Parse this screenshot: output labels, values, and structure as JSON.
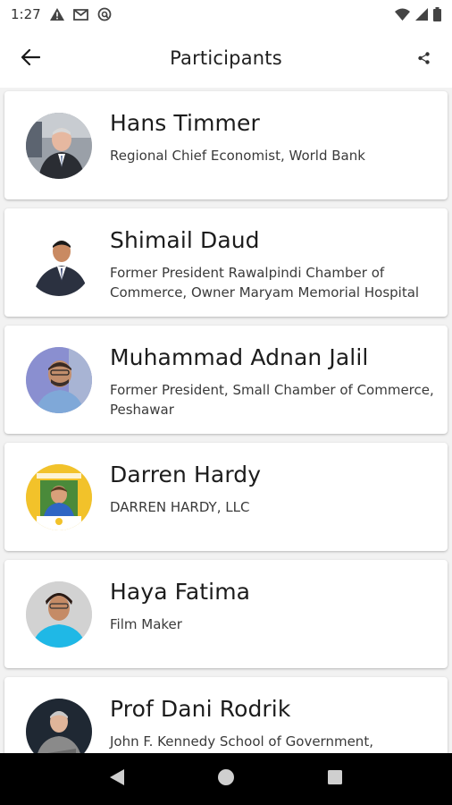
{
  "status_bar": {
    "time": "1:27",
    "left_icons": [
      "warning-icon",
      "gmail-icon",
      "at-sign-icon"
    ],
    "right_icons": [
      "wifi-icon",
      "signal-icon",
      "battery-icon"
    ]
  },
  "app_bar": {
    "title": "Participants",
    "back_icon": "arrow-back-icon",
    "share_icon": "share-icon"
  },
  "participants": [
    {
      "name": "Hans Timmer",
      "role": "Regional Chief Economist, World Bank",
      "avatar_bg": "#8a8f96"
    },
    {
      "name": "Shimail Daud",
      "role": "Former President Rawalpindi Chamber of Commerce, Owner Maryam Memorial Hospital",
      "avatar_bg": "#ffffff"
    },
    {
      "name": "Muhammad Adnan Jalil",
      "role": "Former President, Small Chamber of Commerce, Peshawar",
      "avatar_bg": "#7b80c4"
    },
    {
      "name": "Darren Hardy",
      "role": "DARREN HARDY, LLC",
      "avatar_bg": "#f2c22a"
    },
    {
      "name": "Haya Fatima",
      "role": "Film Maker",
      "avatar_bg": "#cfcfcf"
    },
    {
      "name": "Prof Dani Rodrik",
      "role": "John F. Kennedy School of Government,",
      "avatar_bg": "#1f2833"
    }
  ],
  "nav_bar": {
    "back_icon": "nav-back-icon",
    "home_icon": "nav-home-icon",
    "recents_icon": "nav-recents-icon"
  }
}
